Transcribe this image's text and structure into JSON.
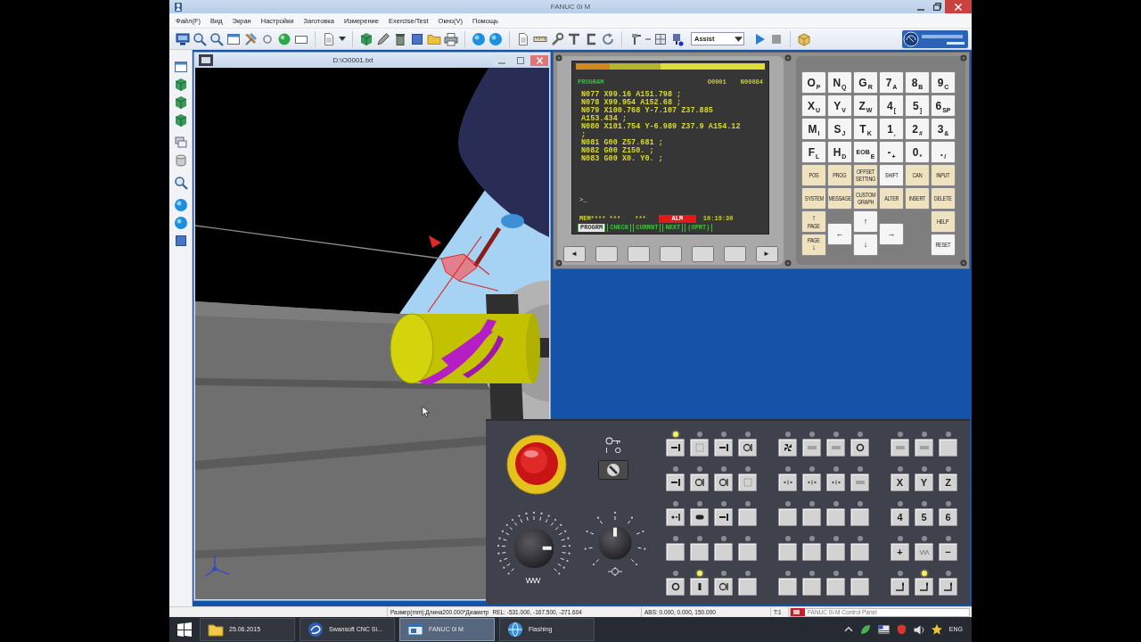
{
  "window": {
    "title": "FANUC 0i M"
  },
  "menu": [
    "Файл(F)",
    "Вид",
    "Экран",
    "Настройки",
    "Заготовка",
    "Измерение",
    "Exercise/Test",
    "Окно(V)",
    "Помощь"
  ],
  "toolbar": {
    "mode": "Assist"
  },
  "viewport": {
    "title": "D:\\O0001.txt"
  },
  "cnc_screen": {
    "header": "PROGRAM",
    "program_number": "O0001",
    "sequence_number": "N00084",
    "lines": [
      "N077 X99.16 A151.798 ;",
      "N078 X99.954 A152.68 ;",
      "N079 X100.768 Y-7.107 Z37.885",
      "A153.434 ;",
      "N080 X101.754 Y-6.989 Z37.9 A154.12",
      ";",
      "N081 G00 Z57.681 ;",
      "N082 G00 Z150. ;",
      "N083 G00 X0. Y0. ;"
    ],
    "prompt": ">_",
    "mode_status": "MEM**** ***",
    "status_2": "***",
    "alarm": "ALM",
    "time": "10:19:30",
    "softkeys": [
      {
        "label": "PROGRM",
        "selected": true
      },
      {
        "label": "CHECK",
        "selected": false
      },
      {
        "label": "CURRNT",
        "selected": false
      },
      {
        "label": "NEXT",
        "selected": false
      },
      {
        "label": "(OPRT)",
        "selected": false
      }
    ]
  },
  "softkey_buttons": [
    {
      "kind": "arrow",
      "label": "◄"
    },
    {
      "kind": "blank"
    },
    {
      "kind": "blank"
    },
    {
      "kind": "blank"
    },
    {
      "kind": "blank"
    },
    {
      "kind": "blank"
    },
    {
      "kind": "arrow",
      "label": "►"
    }
  ],
  "keypad": {
    "char_keys": [
      {
        "main": "O",
        "sub": "P"
      },
      {
        "main": "N",
        "sub": "Q"
      },
      {
        "main": "G",
        "sub": "R"
      },
      {
        "main": "7",
        "sub": "A"
      },
      {
        "main": "8",
        "sub": "B"
      },
      {
        "main": "9",
        "sub": "C"
      },
      {
        "main": "X",
        "sub": "U"
      },
      {
        "main": "Y",
        "sub": "V"
      },
      {
        "main": "Z",
        "sub": "W"
      },
      {
        "main": "4",
        "sub": "["
      },
      {
        "main": "5",
        "sub": "]"
      },
      {
        "main": "6",
        "sub": "SP"
      },
      {
        "main": "M",
        "sub": "I"
      },
      {
        "main": "S",
        "sub": "J"
      },
      {
        "main": "T",
        "sub": "K"
      },
      {
        "main": "1",
        "sub": ","
      },
      {
        "main": "2",
        "sub": "#"
      },
      {
        "main": "3",
        "sub": "&"
      },
      {
        "main": "F",
        "sub": "L"
      },
      {
        "main": "H",
        "sub": "D"
      },
      {
        "main": "EOB",
        "sub": "E"
      },
      {
        "main": "-",
        "sub": "+"
      },
      {
        "main": "0",
        "sub": "*"
      },
      {
        "main": ".",
        "sub": "/"
      }
    ],
    "function_keys": [
      {
        "label": "POS",
        "kind": "func"
      },
      {
        "label": "PROG",
        "kind": "func"
      },
      {
        "label": "OFFSET SETTING",
        "kind": "func"
      },
      {
        "label": "SHIFT",
        "kind": "plain"
      },
      {
        "label": "CAN",
        "kind": "func"
      },
      {
        "label": "INPUT",
        "kind": "func"
      },
      {
        "label": "SYSTEM",
        "kind": "func"
      },
      {
        "label": "MESSAGE",
        "kind": "func"
      },
      {
        "label": "CUSTOM GRAPH",
        "kind": "func"
      },
      {
        "label": "ALTER",
        "kind": "func"
      },
      {
        "label": "INSERT",
        "kind": "func"
      },
      {
        "label": "DELETE",
        "kind": "func"
      }
    ],
    "page_keys": [
      {
        "label": "PAGE",
        "arrow": "↑"
      },
      {
        "label": "PAGE",
        "arrow": "↓"
      }
    ],
    "cursor_keys": [
      "←",
      "↑",
      "↓",
      "→"
    ],
    "help": "HELP",
    "reset": "RESET"
  },
  "operator_panel": {
    "key_switch": {
      "labels": [
        "I",
        "O"
      ],
      "on": true
    },
    "dials": [
      {
        "level": 0.83
      },
      {
        "level": 0.5
      }
    ],
    "groups": [
      {
        "rows": [
          [
            {
              "kind": "icon",
              "lit": true
            },
            {
              "kind": "icon",
              "lit": false
            },
            {
              "kind": "icon",
              "lit": false
            },
            {
              "kind": "icon",
              "lit": false
            }
          ],
          [
            {
              "kind": "icon",
              "lit": false
            },
            {
              "kind": "icon",
              "lit": false
            },
            {
              "kind": "icon",
              "lit": false
            },
            {
              "kind": "icon",
              "lit": false
            }
          ],
          [
            {
              "kind": "icon",
              "lit": false
            },
            {
              "kind": "icon",
              "lit": false
            },
            {
              "kind": "icon",
              "lit": false
            },
            {
              "kind": "blank",
              "lit": false
            }
          ],
          [
            {
              "kind": "blank",
              "lit": false
            },
            {
              "kind": "blank",
              "lit": false
            },
            {
              "kind": "blank",
              "lit": false
            },
            {
              "kind": "blank",
              "lit": false
            }
          ],
          [
            {
              "kind": "icon",
              "lit": false
            },
            {
              "kind": "icon",
              "lit": true
            },
            {
              "kind": "icon",
              "lit": false
            },
            {
              "kind": "blank",
              "lit": false
            }
          ]
        ]
      },
      {
        "rows": [
          [
            {
              "kind": "icon",
              "lit": false
            },
            {
              "kind": "icon",
              "lit": false
            },
            {
              "kind": "icon",
              "lit": false
            },
            {
              "kind": "icon",
              "lit": false
            }
          ],
          [
            {
              "kind": "icon",
              "lit": false
            },
            {
              "kind": "icon",
              "lit": false
            },
            {
              "kind": "icon",
              "lit": false
            },
            {
              "kind": "icon",
              "lit": false
            }
          ],
          [
            {
              "kind": "blank",
              "lit": false
            },
            {
              "kind": "blank",
              "lit": false
            },
            {
              "kind": "blank",
              "lit": false
            },
            {
              "kind": "blank",
              "lit": false
            }
          ],
          [
            {
              "kind": "blank",
              "lit": false
            },
            {
              "kind": "blank",
              "lit": false
            },
            {
              "kind": "blank",
              "lit": false
            },
            {
              "kind": "blank",
              "lit": false
            }
          ],
          [
            {
              "kind": "blank",
              "lit": false
            },
            {
              "kind": "blank",
              "lit": false
            },
            {
              "kind": "blank",
              "lit": false
            },
            {
              "kind": "blank",
              "lit": false
            }
          ]
        ]
      },
      {
        "rows": [
          [
            {
              "kind": "icon",
              "lit": false
            },
            {
              "kind": "icon",
              "lit": false
            },
            {
              "kind": "blank",
              "lit": false
            }
          ],
          [
            {
              "kind": "text",
              "label": "X",
              "lit": false
            },
            {
              "kind": "text",
              "label": "Y",
              "lit": false
            },
            {
              "kind": "text",
              "label": "Z",
              "lit": false
            }
          ],
          [
            {
              "kind": "text",
              "label": "4",
              "lit": false
            },
            {
              "kind": "text",
              "label": "5",
              "lit": false
            },
            {
              "kind": "text",
              "label": "6",
              "lit": false
            }
          ],
          [
            {
              "kind": "text",
              "label": "+",
              "lit": false
            },
            {
              "kind": "icon",
              "lit": false
            },
            {
              "kind": "text",
              "label": "−",
              "lit": false
            }
          ],
          [
            {
              "kind": "icon",
              "lit": false
            },
            {
              "kind": "icon",
              "lit": true
            },
            {
              "kind": "icon",
              "lit": false
            }
          ]
        ]
      }
    ]
  },
  "status_bar": {
    "size": "Размер(mm):Длина200.000*Диаметр",
    "rel": "REL: -531.000, -167.500, -271.604",
    "abs": "ABS: 0.000, 0.000, 150.000",
    "tool": "T:1",
    "panel": "FANUC 0i-M Control Panel"
  },
  "taskbar": {
    "items": [
      {
        "label": "25.06.2015",
        "selected": false
      },
      {
        "label": "Swansoft CNC Si...",
        "selected": false
      },
      {
        "label": "FANUC 0i M",
        "selected": true
      },
      {
        "label": "Flashing",
        "selected": false
      }
    ],
    "language": "ENG"
  }
}
